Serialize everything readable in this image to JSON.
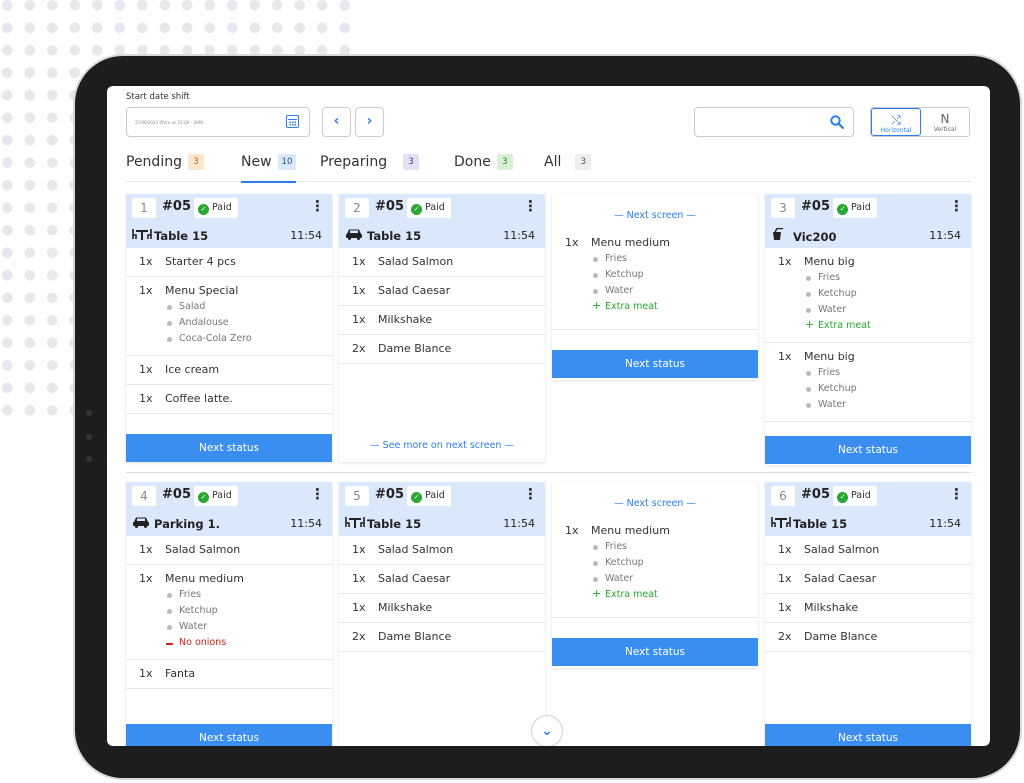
{
  "header": {
    "start_date_label": "Start date shift",
    "date_value": "27/06/2023 (from on 22:00 - 3AM)",
    "prev_glyph": "‹",
    "next_glyph": "›"
  },
  "view_toggle": {
    "horizontal_label": "Horizontal",
    "vertical_label": "Vertical",
    "active": "horizontal"
  },
  "tabs": [
    {
      "label": "Pending",
      "count": "3"
    },
    {
      "label": "New",
      "count": "10"
    },
    {
      "label": "Preparing",
      "count": "3"
    },
    {
      "label": "Done",
      "count": "3"
    },
    {
      "label": "All",
      "count": "3"
    }
  ],
  "active_tab": "New",
  "labels": {
    "paid": "Paid",
    "next_status": "Next status",
    "next_screen": "— Next screen —",
    "see_more": "— See more on next screen —",
    "kebab": "⋮",
    "scroll_down": "⌄"
  },
  "colors": {
    "accent": "#3a8ef0",
    "card_header": "#dbe8fb",
    "paid_green": "#2aa632",
    "removal_red": "#d32020"
  },
  "cards": [
    {
      "num": "1",
      "order": "#05",
      "icon": "table-icon",
      "location": "Table 15",
      "time": "11:54",
      "items": [
        {
          "qty": "1x",
          "name": "Starter 4 pcs",
          "mods": []
        },
        {
          "qty": "1x",
          "name": "Menu Special",
          "mods": [
            {
              "t": "Salad"
            },
            {
              "t": "Andalouse"
            },
            {
              "t": "Coca-Cola Zero"
            }
          ]
        },
        {
          "qty": "1x",
          "name": "Ice cream",
          "mods": []
        },
        {
          "qty": "1x",
          "name": "Coffee latte.",
          "mods": []
        }
      ]
    },
    {
      "num": "2",
      "order": "#05",
      "icon": "car-icon",
      "location": "Table 15",
      "time": "11:54",
      "items": [
        {
          "qty": "1x",
          "name": "Salad Salmon",
          "mods": []
        },
        {
          "qty": "1x",
          "name": "Salad Caesar",
          "mods": []
        },
        {
          "qty": "1x",
          "name": "Milkshake",
          "mods": []
        },
        {
          "qty": "2x",
          "name": "Dame Blance",
          "mods": []
        }
      ]
    },
    {
      "continuation": true,
      "items": [
        {
          "qty": "1x",
          "name": "Menu medium",
          "mods": [
            {
              "t": "Fries"
            },
            {
              "t": "Ketchup"
            },
            {
              "t": "Water"
            },
            {
              "t": "Extra meat",
              "k": "plus"
            }
          ]
        }
      ]
    },
    {
      "num": "3",
      "order": "#05",
      "icon": "takeaway-icon",
      "location": "Vic200",
      "time": "11:54",
      "items": [
        {
          "qty": "1x",
          "name": "Menu big",
          "mods": [
            {
              "t": "Fries"
            },
            {
              "t": "Ketchup"
            },
            {
              "t": "Water"
            },
            {
              "t": "Extra meat",
              "k": "plus"
            }
          ]
        },
        {
          "qty": "1x",
          "name": "Menu big",
          "mods": [
            {
              "t": "Fries"
            },
            {
              "t": "Ketchup"
            },
            {
              "t": "Water"
            }
          ]
        }
      ]
    },
    {
      "num": "4",
      "order": "#05",
      "icon": "car-icon",
      "location": "Parking 1.",
      "time": "11:54",
      "items": [
        {
          "qty": "1x",
          "name": "Salad Salmon",
          "mods": []
        },
        {
          "qty": "1x",
          "name": "Menu medium",
          "mods": [
            {
              "t": "Fries"
            },
            {
              "t": "Ketchup"
            },
            {
              "t": "Water"
            },
            {
              "t": "No onions",
              "k": "minus"
            }
          ]
        },
        {
          "qty": "1x",
          "name": "Fanta",
          "mods": []
        }
      ]
    },
    {
      "num": "5",
      "order": "#05",
      "icon": "table-icon",
      "location": "Table 15",
      "time": "11:54",
      "items": [
        {
          "qty": "1x",
          "name": "Salad Salmon",
          "mods": []
        },
        {
          "qty": "1x",
          "name": "Salad Caesar",
          "mods": []
        },
        {
          "qty": "1x",
          "name": "Milkshake",
          "mods": []
        },
        {
          "qty": "2x",
          "name": "Dame Blance",
          "mods": []
        }
      ]
    },
    {
      "continuation": true,
      "items": [
        {
          "qty": "1x",
          "name": "Menu medium",
          "mods": [
            {
              "t": "Fries"
            },
            {
              "t": "Ketchup"
            },
            {
              "t": "Water"
            },
            {
              "t": "Extra meat",
              "k": "plus"
            }
          ]
        }
      ]
    },
    {
      "num": "6",
      "order": "#05",
      "icon": "table-icon",
      "location": "Table 15",
      "time": "11:54",
      "items": [
        {
          "qty": "1x",
          "name": "Salad Salmon",
          "mods": []
        },
        {
          "qty": "1x",
          "name": "Salad Caesar",
          "mods": []
        },
        {
          "qty": "1x",
          "name": "Milkshake",
          "mods": []
        },
        {
          "qty": "2x",
          "name": "Dame Blance",
          "mods": []
        }
      ]
    }
  ]
}
